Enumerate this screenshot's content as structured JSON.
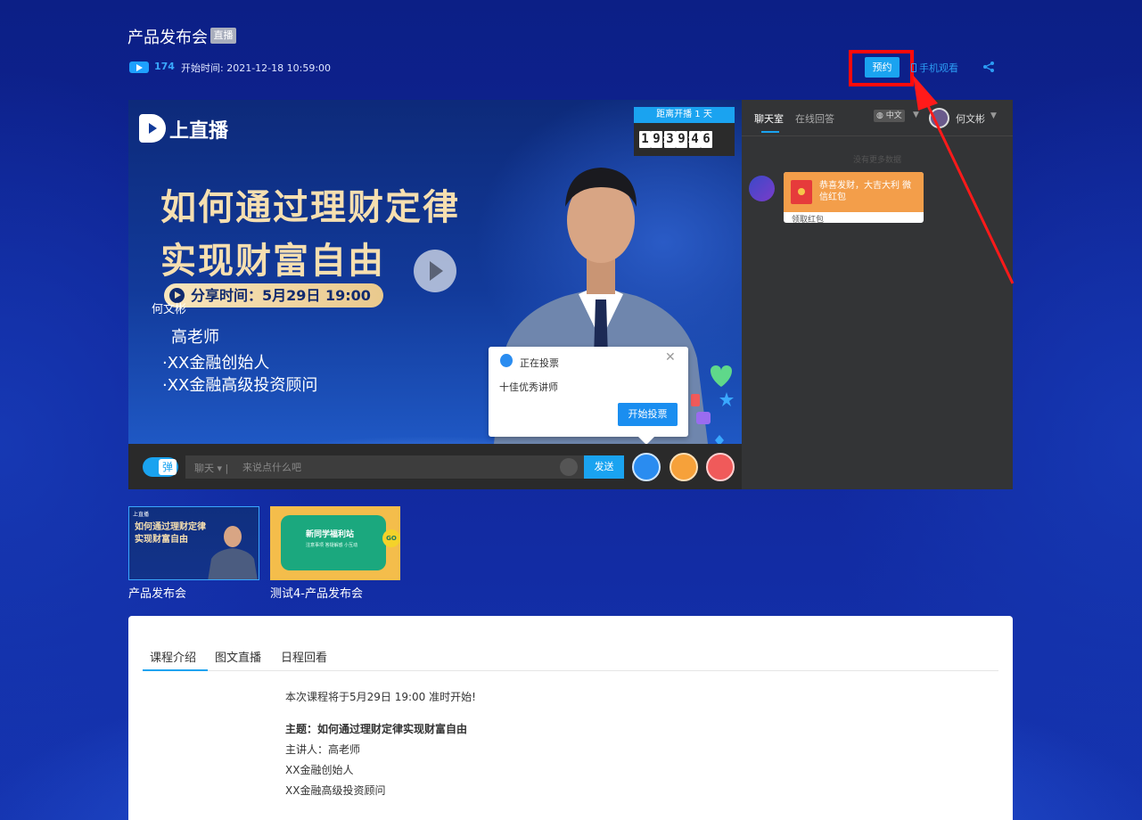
{
  "header": {
    "title": "产品发布会",
    "live_badge": "直播",
    "viewer_count": "174",
    "start_time": "开始时间: 2021-12-18 10:59:00",
    "reserve_label": "预约",
    "phone_watch_label": "手机观看"
  },
  "player": {
    "logo_text": "上直播",
    "headline_1": "如何通过理财定律",
    "headline_2": "实现财富自由",
    "share_time": "分享时间：5月29日 19:00",
    "host_overlay": "何文彬",
    "teacher_name": "高老师",
    "teacher_role_1": "·XX金融创始人",
    "teacher_role_2": "·XX金融高级投资顾问",
    "countdown_label": "距离开播 1 天",
    "countdown_digits": [
      "1",
      "9",
      ":",
      "3",
      "9",
      ":",
      "4",
      "6"
    ]
  },
  "vote_popup": {
    "status": "正在投票",
    "title": "十佳优秀讲师",
    "start_button": "开始投票"
  },
  "control_bar": {
    "danmu_label": "弹",
    "chat_select": "聊天 ▾ |",
    "chat_placeholder": "来说点什么吧",
    "send_label": "发送"
  },
  "chat_panel": {
    "tabs": [
      {
        "label": "聊天室",
        "active": true
      },
      {
        "label": "在线回答",
        "active": false
      }
    ],
    "language": "中文",
    "user_name": "何文彬",
    "no_more_text": "没有更多数据",
    "red_packet_message": "恭喜发财，大吉大利 微信红包",
    "red_packet_claim": "领取红包"
  },
  "thumbnails": [
    {
      "label": "产品发布会",
      "mini_title": "如何通过理财定律实现财富自由",
      "mini_logo": "上直播"
    },
    {
      "label": "测试4-产品发布会",
      "mini_title": "新同学福利站",
      "mini_sub": "注意事项  答疑解惑  小互动",
      "mini_badge": "GO"
    }
  ],
  "content": {
    "tabs": [
      "课程介绍",
      "图文直播",
      "日程回看"
    ],
    "active_tab": "课程介绍",
    "intro": "本次课程将于5月29日 19:00 准时开始!",
    "topic": "主题：如何通过理财定律实现财富自由",
    "speaker": "主讲人：高老师",
    "role_1": "XX金融创始人",
    "role_2": "XX金融高级投资顾问"
  },
  "colors": {
    "accent": "#1aa3f0",
    "highlight_box": "#ff0a0a",
    "arrow": "#ff1a1a",
    "headline_gold": "#f6dfb0",
    "chat_panel_bg": "#333436"
  }
}
